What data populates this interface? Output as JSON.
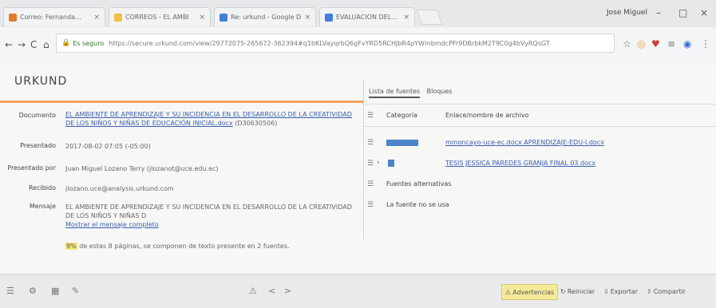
{
  "browser": {
    "tabs": [
      {
        "label": "Correo: Fernanda…",
        "color": "#e07b2c"
      },
      {
        "label": "CORREOS - EL AMBI",
        "color": "#f0c040"
      },
      {
        "label": "Re: urkund - Google D",
        "color": "#3f7fd8"
      },
      {
        "label": "EVALUACION DEL…",
        "color": "#3f7fd8"
      }
    ],
    "user": "Jose Miguel",
    "window_controls": [
      "–",
      "□",
      "×"
    ],
    "nav": [
      "←",
      "→",
      "C",
      "⌂"
    ],
    "secure_label": "Es seguro",
    "url": "https://secure.urkund.com/view/29772075-265672-362394#q1bKLVayqrbQ6gFvYRD5RCHJbR4pYWmbmdcPFr9DBrbkM2T9C0g4bVyRQsGT",
    "toolbar_icons": [
      "☆",
      "◎",
      "♥",
      "≡",
      "◉",
      "⋮"
    ]
  },
  "document": {
    "logo": "URKUND",
    "fields": [
      {
        "label": "Documento",
        "value": "EL AMBIENTE DE APRENDIZAJE Y SU INCIDENCIA EN EL DESARROLLO DE LA CREATIVIDAD DE LOS NIÑOS Y NIÑAS DE EDUCACIÓN INICIAL.docx",
        "suffix": "(D30630506)"
      },
      {
        "label": "Presentado",
        "value": "2017-08-02 07:05 (-05:00)"
      },
      {
        "label": "Presentado por",
        "value": "Juan Miguel Lozano Terry (jlozanot@uce.edu.ec)"
      },
      {
        "label": "Recibido",
        "value": "jlozano.uce@analysis.urkund.com"
      },
      {
        "label": "Mensaje",
        "value": "EL AMBIENTE DE APRENDIZAJE Y SU INCIDENCIA EN EL DESARROLLO DE LA CREATIVIDAD DE LOS NIÑOS Y NIÑAS D",
        "link": "Mostrar el mensaje completo"
      }
    ],
    "summary_pct": "9%",
    "summary_text": "de estas 8 páginas, se componen de texto presente en 2 fuentes."
  },
  "sources": {
    "tabs": [
      "Lista de fuentes",
      "Bloques"
    ],
    "header_category": "Categoría",
    "header_link": "Enlace/nombre de archivo",
    "rows": [
      {
        "category": "",
        "source": "mmoncayo-uce-ec.docx APRENDIZAJE-EDU-I.docx"
      },
      {
        "category": "",
        "source": "TESIS JESSICA PAREDES GRANJA FINAL 03.docx"
      },
      {
        "category": "Fuentes alternativas",
        "source": ""
      },
      {
        "category": "La fuente no se usa",
        "source": ""
      }
    ]
  },
  "bottom": {
    "left_icons": [
      "☰",
      "⚙",
      "▦",
      "✎"
    ],
    "center_icons": [
      "⚠",
      "<",
      ">"
    ],
    "buttons": [
      "Advertencias",
      "Reiniciar",
      "Exportar",
      "Compartir"
    ]
  }
}
